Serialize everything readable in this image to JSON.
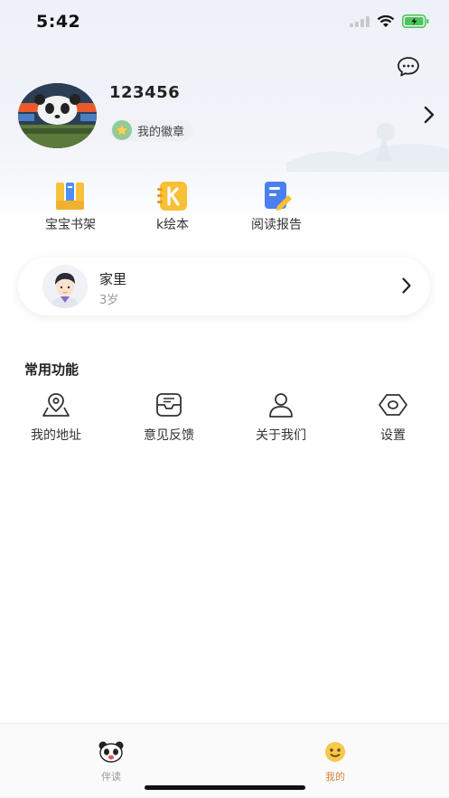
{
  "status_bar": {
    "time": "5:42"
  },
  "profile": {
    "username": "123456",
    "badge_label": "我的徽章"
  },
  "quick_entries": [
    {
      "label": "宝宝书架",
      "icon": "bookshelf-icon"
    },
    {
      "label": "k绘本",
      "icon": "k-picturebook-icon"
    },
    {
      "label": "阅读报告",
      "icon": "reading-report-icon"
    }
  ],
  "family": {
    "name": "家里",
    "age": "3岁"
  },
  "common": {
    "title": "常用功能",
    "items": [
      {
        "label": "我的地址",
        "icon": "location-icon"
      },
      {
        "label": "意见反馈",
        "icon": "feedback-icon"
      },
      {
        "label": "关于我们",
        "icon": "user-icon"
      },
      {
        "label": "设置",
        "icon": "settings-icon"
      }
    ]
  },
  "tabs": [
    {
      "label": "伴读",
      "icon": "panda-icon",
      "active": false
    },
    {
      "label": "我的",
      "icon": "smiley-icon",
      "active": true
    }
  ],
  "colors": {
    "accent": "#e8a640",
    "active_tab": "#d9823a",
    "inactive_tab": "#999999"
  }
}
